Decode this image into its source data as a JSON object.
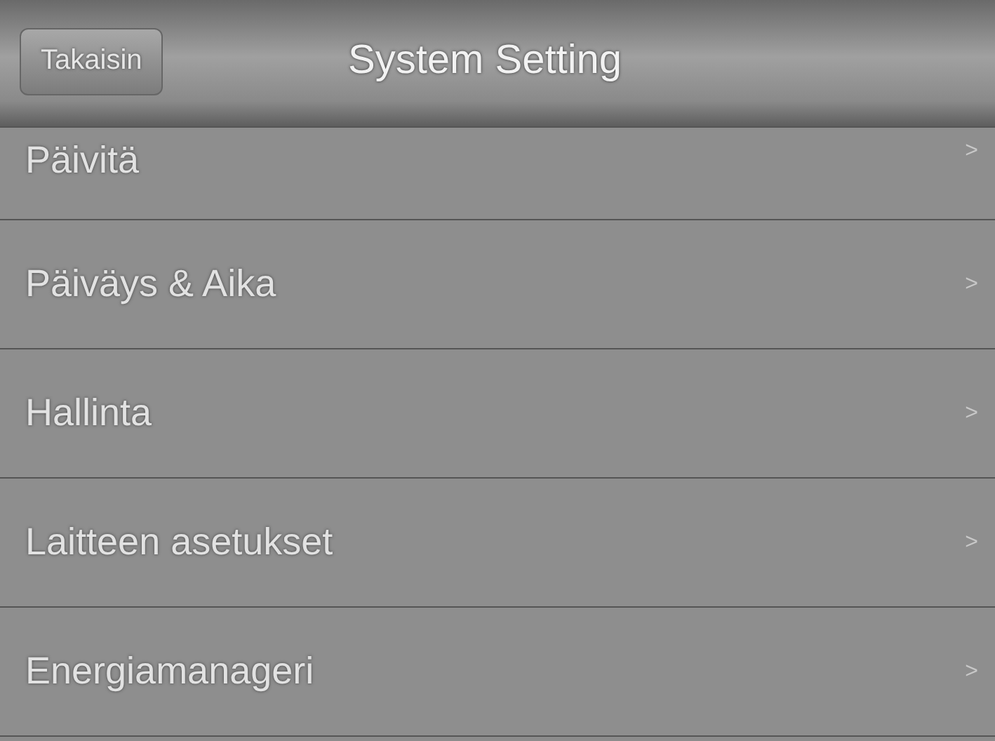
{
  "header": {
    "back_button": "Takaisin",
    "title": "System Setting"
  },
  "items": [
    {
      "label": "Päivitä",
      "chevron": ">"
    },
    {
      "label": "Päiväys & Aika",
      "chevron": ">"
    },
    {
      "label": "Hallinta",
      "chevron": ">"
    },
    {
      "label": "Laitteen asetukset",
      "chevron": ">"
    },
    {
      "label": "Energiamanageri",
      "chevron": ">"
    }
  ]
}
